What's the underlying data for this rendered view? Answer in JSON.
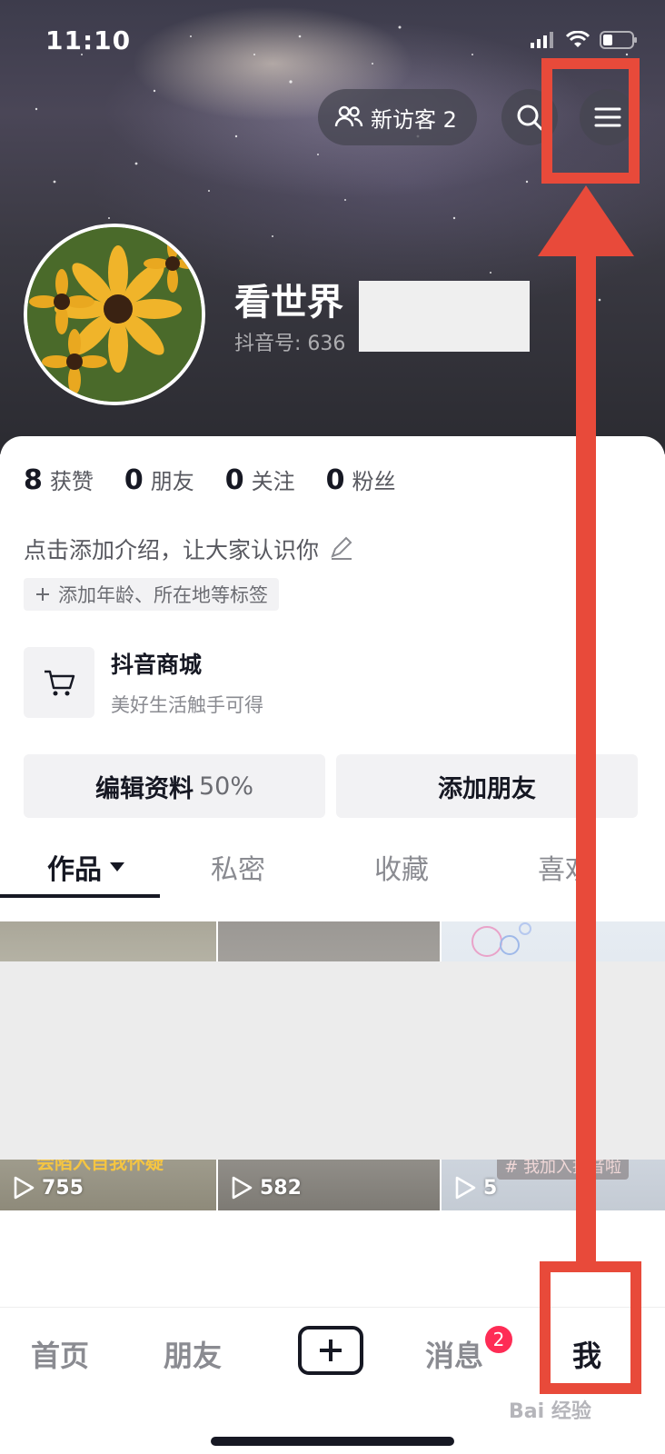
{
  "status_bar": {
    "time": "11:10"
  },
  "header": {
    "visitor_label": "新访客 2",
    "username": "看世界",
    "douyin_id": "抖音号: 636"
  },
  "stats": [
    {
      "num": "8",
      "label": "获赞"
    },
    {
      "num": "0",
      "label": "朋友"
    },
    {
      "num": "0",
      "label": "关注"
    },
    {
      "num": "0",
      "label": "粉丝"
    }
  ],
  "bio": {
    "text": "点击添加介绍，让大家认识你",
    "tag_chip": "添加年龄、所在地等标签"
  },
  "shop": {
    "title": "抖音商城",
    "subtitle": "美好生活触手可得"
  },
  "actions": {
    "edit_label": "编辑资料",
    "edit_percent": "50%",
    "add_friend_label": "添加朋友"
  },
  "tabs": [
    {
      "label": "作品"
    },
    {
      "label": "私密"
    },
    {
      "label": "收藏"
    },
    {
      "label": "喜欢"
    }
  ],
  "videos": [
    {
      "plays": "755",
      "overlay": "会陷入自我怀疑"
    },
    {
      "plays": "582"
    },
    {
      "plays": "5",
      "hashtag": "# 我加入抖音啦"
    }
  ],
  "bottom_nav": {
    "home": "首页",
    "friends": "朋友",
    "messages": "消息",
    "messages_badge": "2",
    "me": "我"
  },
  "watermark": "Bai 经验",
  "colors": {
    "accent_red": "#fe2c55",
    "annotation_red": "#e84a3a",
    "text_primary": "#161823"
  }
}
